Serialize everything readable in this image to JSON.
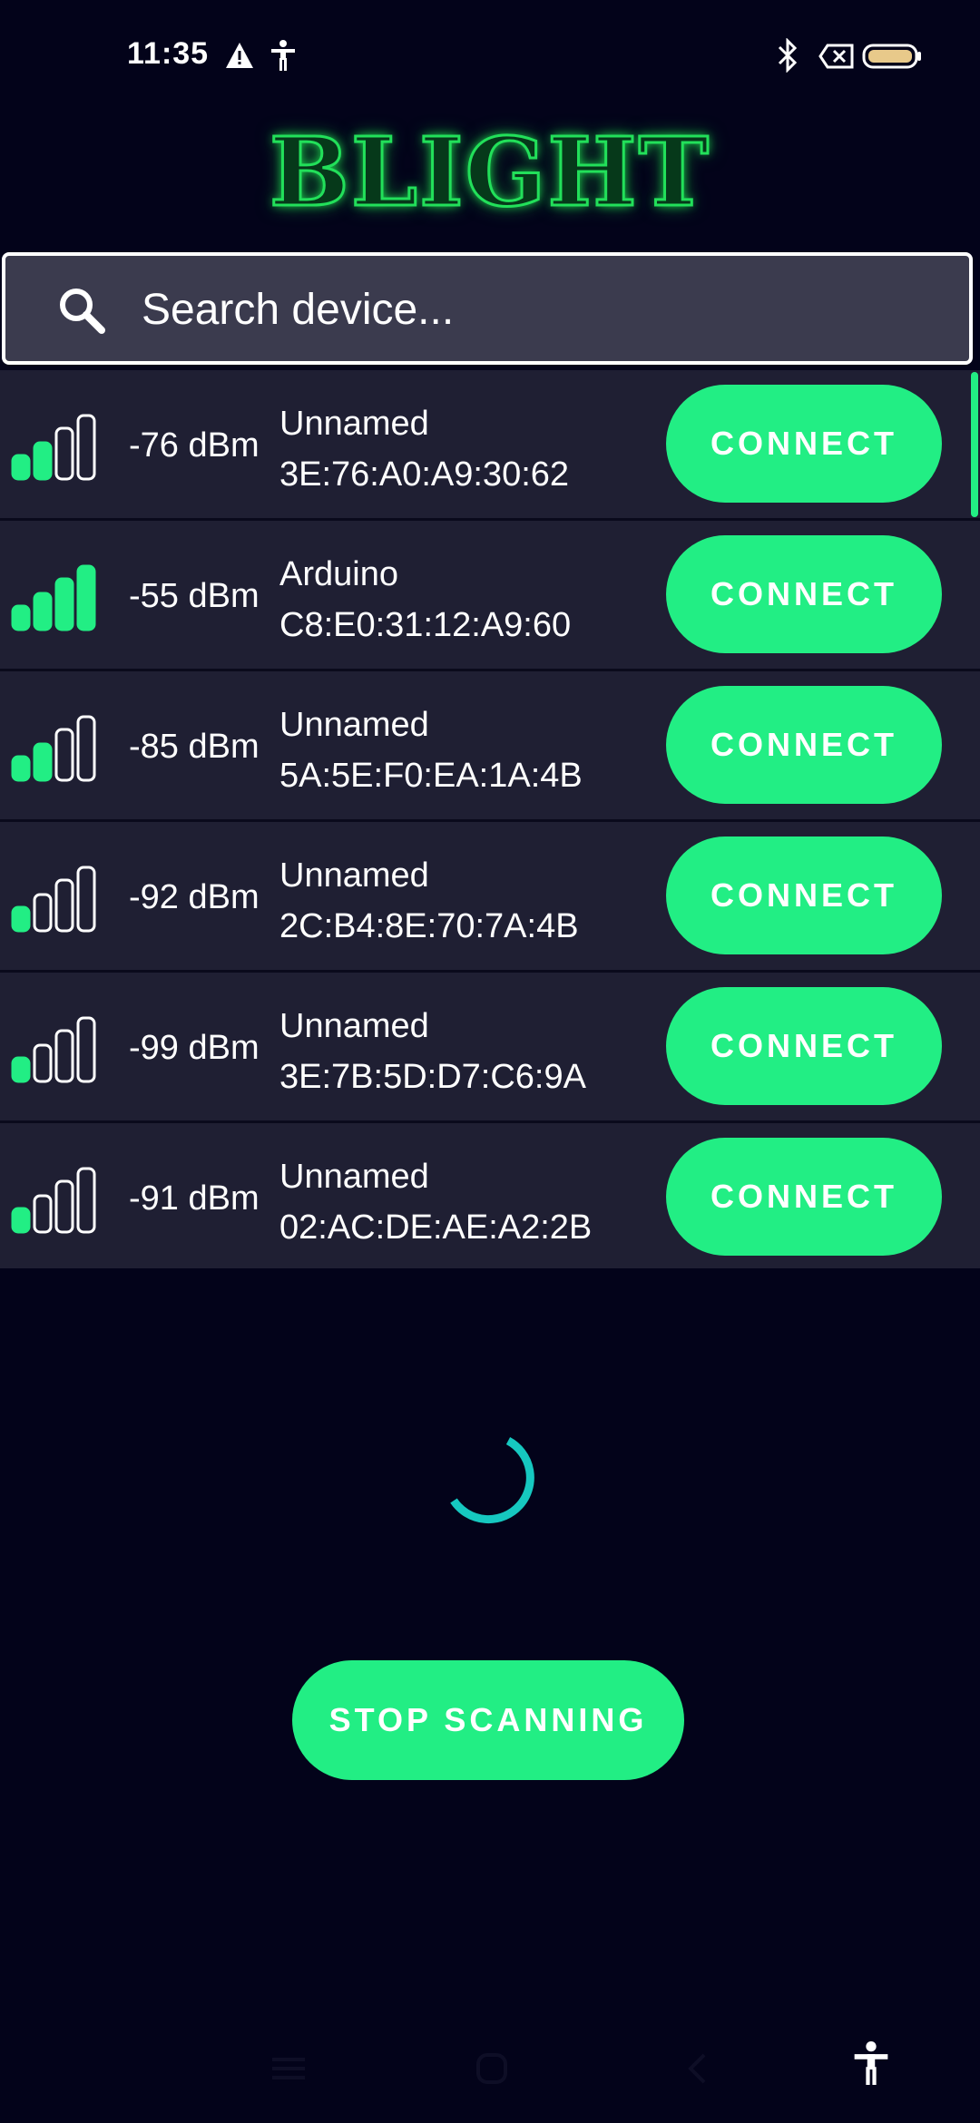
{
  "status_bar": {
    "time": "11:35",
    "icons": [
      "warning-icon",
      "accessibility-icon",
      "bluetooth-icon",
      "sim-error-icon",
      "battery-icon"
    ]
  },
  "app": {
    "logo_text": "BLIGHT",
    "accent_color": "#22ee84",
    "logo_color": "#22e05a"
  },
  "search": {
    "placeholder": "Search device...",
    "value": ""
  },
  "devices": [
    {
      "rssi": "-76 dBm",
      "name": "Unnamed",
      "mac": "3E:76:A0:A9:30:62",
      "signal_bars": 2,
      "connect_label": "CONNECT"
    },
    {
      "rssi": "-55 dBm",
      "name": "Arduino",
      "mac": "C8:E0:31:12:A9:60",
      "signal_bars": 4,
      "connect_label": "CONNECT"
    },
    {
      "rssi": "-85 dBm",
      "name": "Unnamed",
      "mac": "5A:5E:F0:EA:1A:4B",
      "signal_bars": 2,
      "connect_label": "CONNECT"
    },
    {
      "rssi": "-92 dBm",
      "name": "Unnamed",
      "mac": "2C:B4:8E:70:7A:4B",
      "signal_bars": 1,
      "connect_label": "CONNECT"
    },
    {
      "rssi": "-99 dBm",
      "name": "Unnamed",
      "mac": "3E:7B:5D:D7:C6:9A",
      "signal_bars": 1,
      "connect_label": "CONNECT"
    },
    {
      "rssi": "-91 dBm",
      "name": "Unnamed",
      "mac": "02:AC:DE:AE:A2:2B",
      "signal_bars": 1,
      "connect_label": "CONNECT"
    }
  ],
  "scanning": {
    "stop_label": "STOP SCANNING"
  },
  "nav_bar": {
    "icons": [
      "menu-icon",
      "home-icon",
      "back-icon",
      "accessibility-icon"
    ]
  }
}
